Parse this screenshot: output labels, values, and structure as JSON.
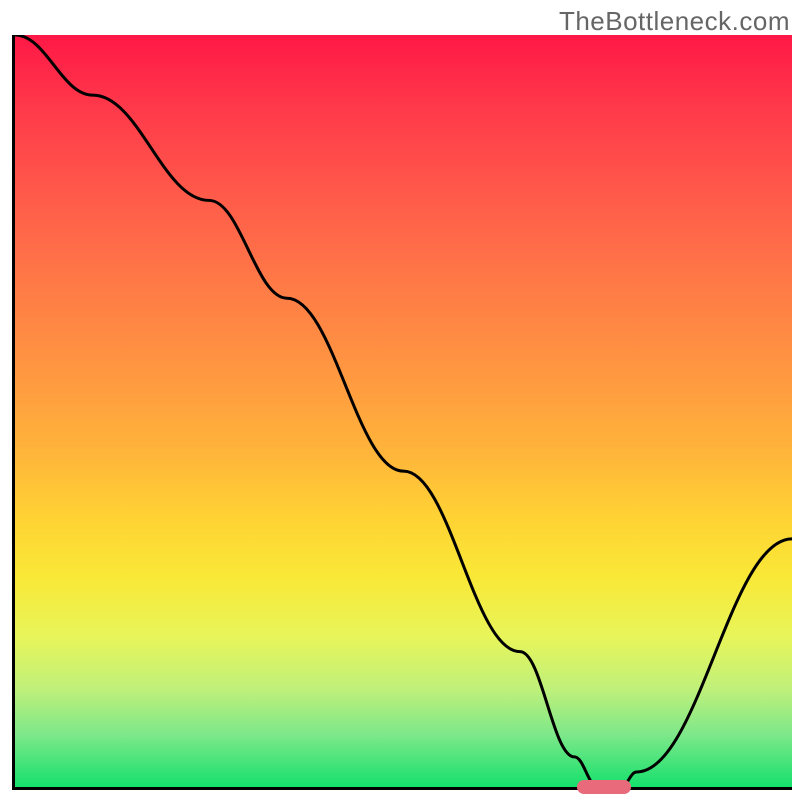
{
  "watermark": "TheBottleneck.com",
  "chart_data": {
    "type": "line",
    "title": "",
    "xlabel": "",
    "ylabel": "",
    "xlim": [
      0,
      100
    ],
    "ylim": [
      0,
      100
    ],
    "grid": false,
    "series": [
      {
        "name": "bottleneck-curve",
        "x": [
          0,
          10,
          25,
          35,
          50,
          65,
          72,
          75,
          78,
          80,
          100
        ],
        "values": [
          100,
          92,
          78,
          65,
          42,
          18,
          4,
          0,
          0,
          2,
          33
        ]
      }
    ],
    "marker": {
      "x_start": 72,
      "x_end": 79,
      "y": 0
    },
    "gradient": {
      "top": "#ff1846",
      "mid": "#ffd234",
      "bottom": "#15e06c"
    }
  }
}
